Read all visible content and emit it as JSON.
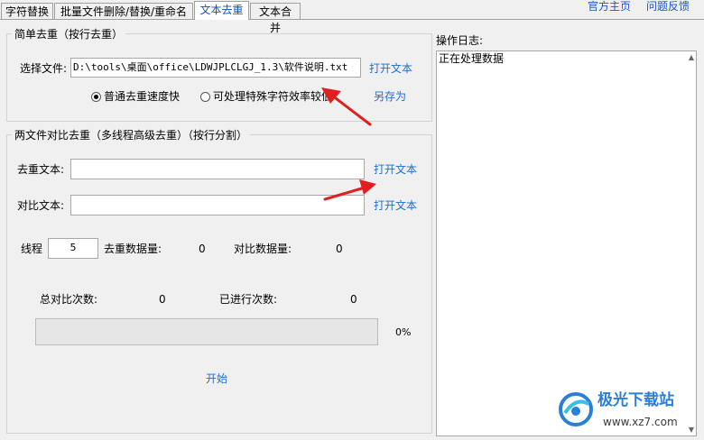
{
  "tabs": [
    {
      "label": "字符替换",
      "active": false
    },
    {
      "label": "批量文件删除/替换/重命名",
      "active": false
    },
    {
      "label": "文本去重",
      "active": true
    },
    {
      "label": "文本合并",
      "active": false
    }
  ],
  "top_links": {
    "home": "官方主页",
    "feedback": "问题反馈"
  },
  "simple_dedup": {
    "title": "简单去重（按行去重）",
    "file_label": "选择文件:",
    "file_value": "D:\\tools\\桌面\\office\\LDWJPLCLGJ_1.3\\软件说明.txt",
    "open_button": "打开文本",
    "save_as_button": "另存为",
    "radio_fast": "普通去重速度快",
    "radio_special": "可处理特殊字符效率较低",
    "selected": "fast"
  },
  "compare_dedup": {
    "title": "两文件对比去重（多线程高级去重）（按行分割）",
    "dedup_label": "去重文本:",
    "dedup_value": "",
    "dedup_open": "打开文本",
    "compare_label": "对比文本:",
    "compare_value": "",
    "compare_open": "打开文本",
    "threads_label": "线程",
    "threads_value": "5",
    "dedup_count_label": "去重数据量:",
    "dedup_count_value": "0",
    "compare_count_label": "对比数据量:",
    "compare_count_value": "0",
    "total_label": "总对比次数:",
    "total_value": "0",
    "done_label": "已进行次数:",
    "done_value": "0",
    "progress_text": "0%",
    "progress_fraction": 0,
    "start_button": "开始"
  },
  "log": {
    "title": "操作日志:",
    "content": "正在处理数据"
  },
  "watermark": {
    "name": "极光下载站",
    "url": "www.xz7.com"
  },
  "colors": {
    "link": "#1a6fd0",
    "arrow": "#e02020",
    "progress": "#06b025"
  }
}
